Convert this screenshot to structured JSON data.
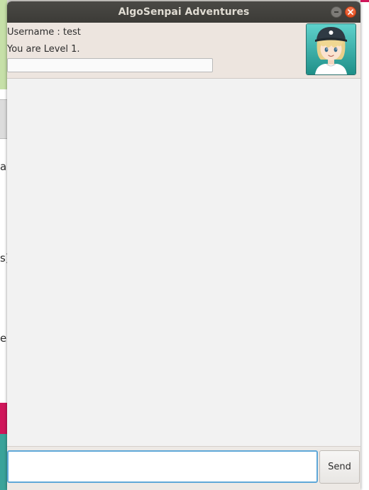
{
  "window": {
    "title": "AlgoSenpai Adventures"
  },
  "header": {
    "username_text": "Username : test",
    "level_text": "You are Level 1.",
    "progress": 0
  },
  "avatar": {
    "icon": "character-avatar-icon"
  },
  "chat": {
    "messages": []
  },
  "input": {
    "value": "",
    "placeholder": ""
  },
  "send": {
    "label": "Send"
  },
  "background": {
    "fragments": [
      "a",
      "s)",
      "e"
    ]
  },
  "colors": {
    "titlebar": "#3c3b37",
    "header_bg": "#ede5df",
    "chat_bg": "#f2f2f2",
    "input_focus": "#5fa8d8",
    "close_button": "#e14c1e"
  }
}
